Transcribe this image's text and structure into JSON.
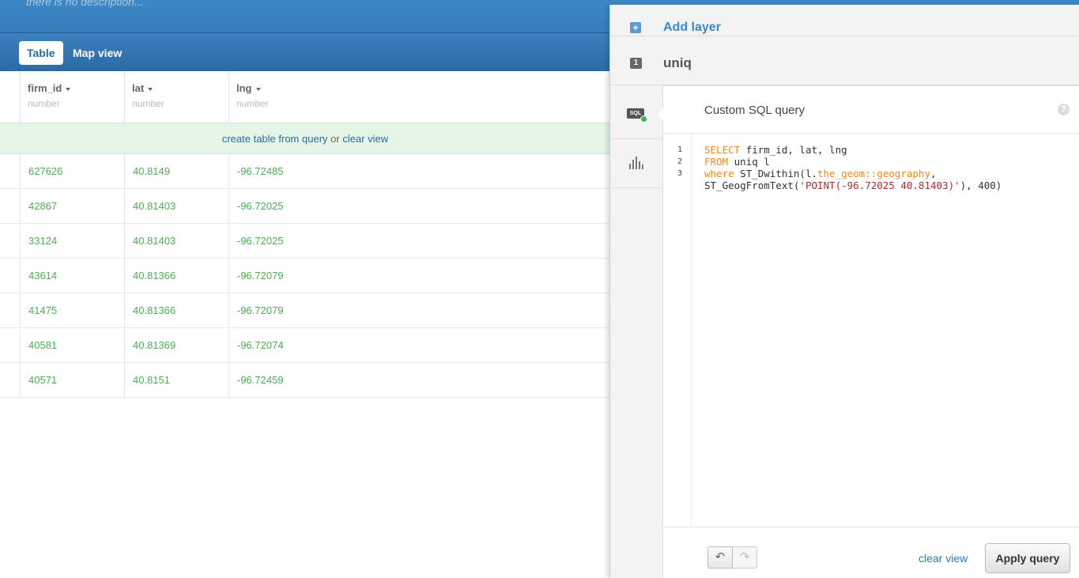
{
  "header": {
    "description": "there is no description..."
  },
  "tabs": {
    "table": "Table",
    "map_view": "Map view"
  },
  "columns": [
    {
      "name": "firm_id",
      "type": "number"
    },
    {
      "name": "lat",
      "type": "number"
    },
    {
      "name": "lng",
      "type": "number"
    }
  ],
  "notice": {
    "create_link": "create table from query",
    "or": "or",
    "clear_link": "clear view"
  },
  "rows": [
    [
      "627626",
      "40.8149",
      "-96.72485"
    ],
    [
      "42867",
      "40.81403",
      "-96.72025"
    ],
    [
      "33124",
      "40.81403",
      "-96.72025"
    ],
    [
      "43614",
      "40.81366",
      "-96.72079"
    ],
    [
      "41475",
      "40.81366",
      "-96.72079"
    ],
    [
      "40581",
      "40.81369",
      "-96.72074"
    ],
    [
      "40571",
      "40.8151",
      "-96.72459"
    ]
  ],
  "panel": {
    "add_layer": "Add layer",
    "layer_number": "1",
    "layer_name": "uniq",
    "sql_icon_label": "SQL",
    "editor_title": "Custom SQL query",
    "help": "?",
    "line_numbers": [
      "1",
      "2",
      "3"
    ],
    "code_line1_kw": "SELECT",
    "code_line1_rest": " firm_id, lat, lng",
    "code_line2_kw": "FROM",
    "code_line2_rest": " uniq l",
    "code_line3_kw": "where",
    "code_line3_a": " ST_Dwithin(l.",
    "code_line3_b": "the_geom::geography",
    "code_line3_c": ",",
    "code_line4_a": "ST_GeogFromText(",
    "code_line4_str": "'POINT(-96.72025 40.81403)'",
    "code_line4_c": "), 400)",
    "clear_view": "clear view",
    "apply": "Apply query"
  },
  "colors": {
    "accent": "#2f74b2",
    "row_value": "#4caf50",
    "keyword": "#f08a1c",
    "string": "#b02a2a"
  },
  "icons": {
    "add": "plus-icon",
    "undo": "undo-icon",
    "redo": "redo-icon",
    "stats": "histogram-icon"
  }
}
